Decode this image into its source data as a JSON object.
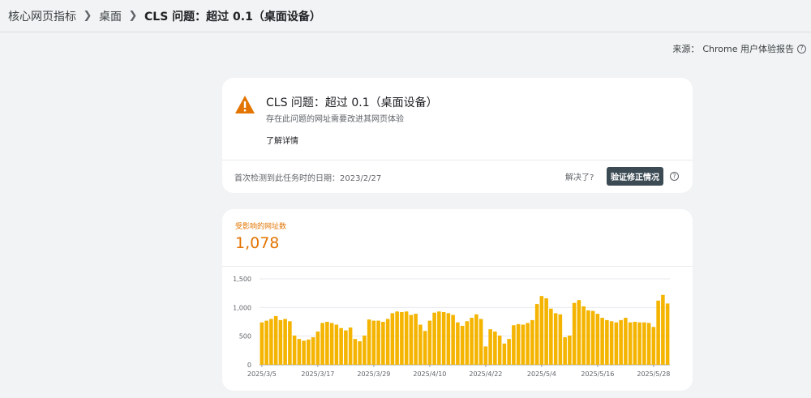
{
  "breadcrumb": {
    "items": [
      "核心网页指标",
      "桌面",
      "CLS 问题：超过 0.1（桌面设备）"
    ]
  },
  "source": {
    "label": "来源：",
    "value": "Chrome 用户体验报告"
  },
  "issue": {
    "title": "CLS 问题：超过 0.1（桌面设备）",
    "subtitle": "存在此问题的网址需要改进其网页体验",
    "learn_more": "了解详情",
    "first_detected": "首次检测到此任务时的日期：2023/2/27",
    "resolved_question": "解决了?",
    "validate_button": "验证修正情况",
    "warning_color": "#e37400"
  },
  "metric": {
    "label": "受影响的网址数",
    "value": "1,078",
    "color": "#e37400"
  },
  "chart_data": {
    "type": "bar",
    "color": "#f4b400",
    "ylim": [
      0,
      1500
    ],
    "yticks": [
      "0",
      "500",
      "1,000",
      "1,500"
    ],
    "xtick_labels": [
      "2025/3/5",
      "2025/3/17",
      "2025/3/29",
      "2025/4/10",
      "2025/4/22",
      "2025/5/4",
      "2025/5/16",
      "2025/5/28"
    ],
    "xtick_index": [
      0,
      12,
      24,
      36,
      48,
      60,
      72,
      84
    ],
    "values": [
      740,
      770,
      800,
      850,
      780,
      800,
      760,
      510,
      450,
      420,
      440,
      480,
      580,
      730,
      750,
      730,
      700,
      640,
      600,
      650,
      450,
      410,
      510,
      790,
      770,
      770,
      750,
      800,
      900,
      930,
      920,
      930,
      870,
      890,
      700,
      590,
      770,
      910,
      930,
      920,
      900,
      870,
      740,
      680,
      760,
      820,
      880,
      800,
      320,
      620,
      580,
      510,
      370,
      450,
      690,
      710,
      700,
      730,
      780,
      1060,
      1200,
      1160,
      980,
      900,
      880,
      480,
      510,
      1080,
      1130,
      1020,
      950,
      940,
      890,
      820,
      780,
      760,
      740,
      780,
      820,
      740,
      750,
      740,
      740,
      730,
      660,
      1120,
      1220,
      1070
    ]
  }
}
